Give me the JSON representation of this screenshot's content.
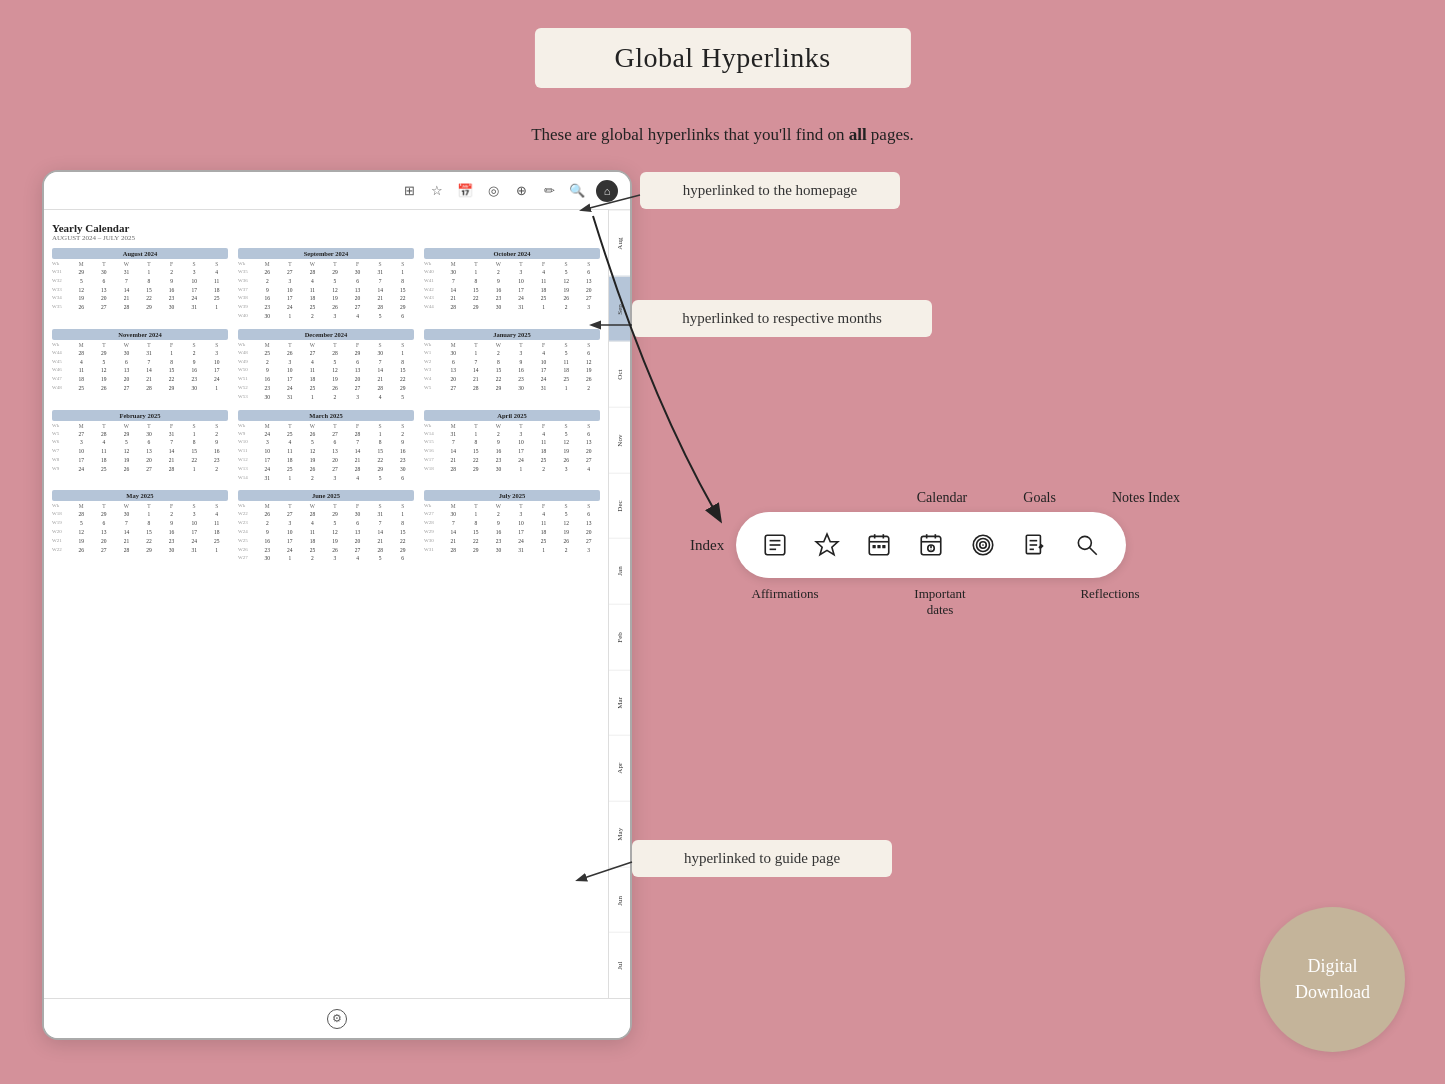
{
  "page": {
    "title": "Global Hyperlinks",
    "subtitle_start": "These are global hyperlinks that you'll find on ",
    "subtitle_bold": "all",
    "subtitle_end": " pages.",
    "bg_color": "#d4919a"
  },
  "annotations": {
    "homepage": "hyperlinked to the homepage",
    "months": "hyperlinked to respective months",
    "guide": "hyperlinked to guide page"
  },
  "toolbar_labels": {
    "index": "Index",
    "calendar": "Calendar",
    "goals": "Goals",
    "notes_index": "Notes Index",
    "affirmations": "Affirmations",
    "important_dates": "Important\ndates",
    "reflections": "Reflections"
  },
  "calendar": {
    "title": "Yearly Calendar",
    "subtitle": "AUGUST 2024 – JULY 2025"
  },
  "digital_download": {
    "line1": "Digital",
    "line2": "Download"
  },
  "months": [
    "Aug",
    "Sep",
    "Oct",
    "Nov",
    "Dec",
    "Jan",
    "Feb",
    "Mar",
    "Apr",
    "May",
    "Jun",
    "Jul"
  ]
}
